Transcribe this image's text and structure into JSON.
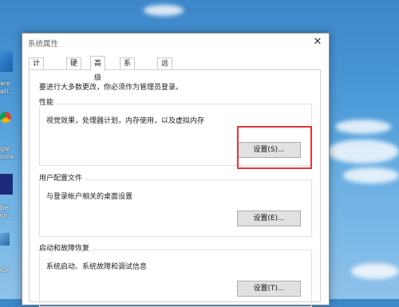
{
  "desktop": {
    "labels": [
      "are\nati...",
      "gle\nome",
      "be\nsh...",
      "ick"
    ]
  },
  "window": {
    "title": "系统属性",
    "close_glyph": "✕"
  },
  "tabs": [
    {
      "label": "计算机名"
    },
    {
      "label": "硬件"
    },
    {
      "label": "高级"
    },
    {
      "label": "系统保护"
    },
    {
      "label": "远程"
    }
  ],
  "advanced": {
    "admin_note": "要进行大多数更改，你必须作为管理员登录。",
    "performance": {
      "label": "性能",
      "description": "视觉效果，处理器计划，内存使用，以及虚拟内存",
      "button": "设置(S)..."
    },
    "user_profiles": {
      "label": "用户配置文件",
      "description": "与登录帐户相关的桌面设置",
      "button": "设置(E)..."
    },
    "startup_recovery": {
      "label": "启动和故障恢复",
      "description": "系统启动、系统故障和调试信息",
      "button": "设置(T)..."
    }
  },
  "colors": {
    "highlight": "#e03838"
  }
}
